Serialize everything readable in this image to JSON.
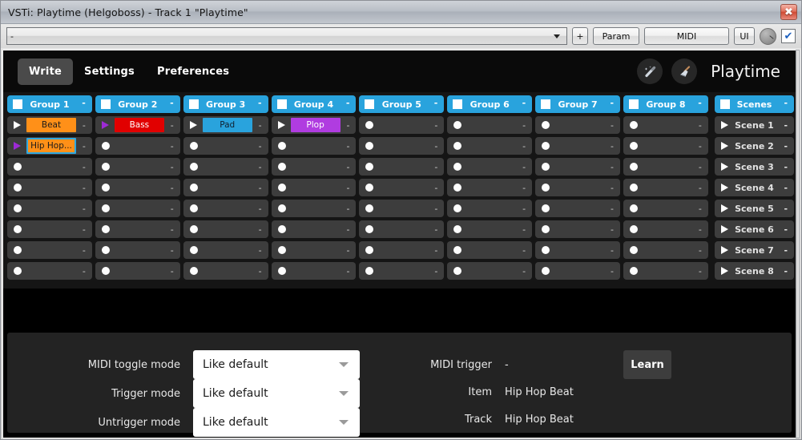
{
  "window": {
    "title": "VSTi: Playtime (Helgoboss) - Track 1 \"Playtime\"",
    "close_label": "✖"
  },
  "host_toolbar": {
    "preset_value": "-",
    "add_label": "+",
    "param_label": "Param",
    "midi_label": "MIDI",
    "ui_label": "UI",
    "checkbox_mark": "✔"
  },
  "plugin_header": {
    "tabs": [
      {
        "label": "Write",
        "active": true
      },
      {
        "label": "Settings",
        "active": false
      },
      {
        "label": "Preferences",
        "active": false
      }
    ],
    "plugin_name": "Playtime"
  },
  "colors": {
    "accent_cyan": "#29a3dd",
    "clip_orange": "#ff9018",
    "clip_red": "#e10000",
    "clip_blue": "#29a3dd",
    "clip_purple": "#b03ce0",
    "slot_grey": "#3d3d3d",
    "selection_border": "#2fa8e0",
    "play_purple": "#9d2ad6"
  },
  "matrix": {
    "dash": "-",
    "groups": [
      {
        "name": "Group 1",
        "dash": "-"
      },
      {
        "name": "Group 2",
        "dash": "-"
      },
      {
        "name": "Group 3",
        "dash": "-"
      },
      {
        "name": "Group 4",
        "dash": "-"
      },
      {
        "name": "Group 5",
        "dash": "-"
      },
      {
        "name": "Group 6",
        "dash": "-"
      },
      {
        "name": "Group 7",
        "dash": "-"
      },
      {
        "name": "Group 8",
        "dash": "-"
      }
    ],
    "scenes_header": {
      "name": "Scenes",
      "dash": "-"
    },
    "scenes": [
      {
        "name": "Scene 1",
        "dash": "-"
      },
      {
        "name": "Scene 2",
        "dash": "-"
      },
      {
        "name": "Scene 3",
        "dash": "-"
      },
      {
        "name": "Scene 4",
        "dash": "-"
      },
      {
        "name": "Scene 5",
        "dash": "-"
      },
      {
        "name": "Scene 6",
        "dash": "-"
      },
      {
        "name": "Scene 7",
        "dash": "-"
      },
      {
        "name": "Scene 8",
        "dash": "-"
      }
    ],
    "rows": [
      [
        {
          "clip": "Beat",
          "color": "#ff9018",
          "text": "#1a1a1a",
          "control": "play",
          "control_color": "white",
          "selected": false
        },
        {
          "clip": "Bass",
          "color": "#e10000",
          "text": "#ffffff",
          "control": "play",
          "control_color": "purple",
          "selected": false
        },
        {
          "clip": "Pad",
          "color": "#29a3dd",
          "text": "#102030",
          "control": "play",
          "control_color": "white",
          "selected": false
        },
        {
          "clip": "Plop",
          "color": "#b03ce0",
          "text": "#ffffff",
          "control": "play",
          "control_color": "white",
          "selected": false
        },
        {
          "clip": null,
          "control": "record"
        },
        {
          "clip": null,
          "control": "record"
        },
        {
          "clip": null,
          "control": "record"
        },
        {
          "clip": null,
          "control": "record"
        }
      ],
      [
        {
          "clip": "Hip Hop...",
          "color": "#ff9018",
          "text": "#1a1a1a",
          "control": "play",
          "control_color": "purple",
          "selected": true
        },
        {
          "clip": null,
          "control": "record"
        },
        {
          "clip": null,
          "control": "record"
        },
        {
          "clip": null,
          "control": "record"
        },
        {
          "clip": null,
          "control": "record"
        },
        {
          "clip": null,
          "control": "record"
        },
        {
          "clip": null,
          "control": "record"
        },
        {
          "clip": null,
          "control": "record"
        }
      ],
      [
        {
          "clip": null,
          "control": "record"
        },
        {
          "clip": null,
          "control": "record"
        },
        {
          "clip": null,
          "control": "record"
        },
        {
          "clip": null,
          "control": "record"
        },
        {
          "clip": null,
          "control": "record"
        },
        {
          "clip": null,
          "control": "record"
        },
        {
          "clip": null,
          "control": "record"
        },
        {
          "clip": null,
          "control": "record"
        }
      ],
      [
        {
          "clip": null,
          "control": "record"
        },
        {
          "clip": null,
          "control": "record"
        },
        {
          "clip": null,
          "control": "record"
        },
        {
          "clip": null,
          "control": "record"
        },
        {
          "clip": null,
          "control": "record"
        },
        {
          "clip": null,
          "control": "record"
        },
        {
          "clip": null,
          "control": "record"
        },
        {
          "clip": null,
          "control": "record"
        }
      ],
      [
        {
          "clip": null,
          "control": "record"
        },
        {
          "clip": null,
          "control": "record"
        },
        {
          "clip": null,
          "control": "record"
        },
        {
          "clip": null,
          "control": "record"
        },
        {
          "clip": null,
          "control": "record"
        },
        {
          "clip": null,
          "control": "record"
        },
        {
          "clip": null,
          "control": "record"
        },
        {
          "clip": null,
          "control": "record"
        }
      ],
      [
        {
          "clip": null,
          "control": "record"
        },
        {
          "clip": null,
          "control": "record"
        },
        {
          "clip": null,
          "control": "record"
        },
        {
          "clip": null,
          "control": "record"
        },
        {
          "clip": null,
          "control": "record"
        },
        {
          "clip": null,
          "control": "record"
        },
        {
          "clip": null,
          "control": "record"
        },
        {
          "clip": null,
          "control": "record"
        }
      ],
      [
        {
          "clip": null,
          "control": "record"
        },
        {
          "clip": null,
          "control": "record"
        },
        {
          "clip": null,
          "control": "record"
        },
        {
          "clip": null,
          "control": "record"
        },
        {
          "clip": null,
          "control": "record"
        },
        {
          "clip": null,
          "control": "record"
        },
        {
          "clip": null,
          "control": "record"
        },
        {
          "clip": null,
          "control": "record"
        }
      ],
      [
        {
          "clip": null,
          "control": "record"
        },
        {
          "clip": null,
          "control": "record"
        },
        {
          "clip": null,
          "control": "record"
        },
        {
          "clip": null,
          "control": "record"
        },
        {
          "clip": null,
          "control": "record"
        },
        {
          "clip": null,
          "control": "record"
        },
        {
          "clip": null,
          "control": "record"
        },
        {
          "clip": null,
          "control": "record"
        }
      ]
    ]
  },
  "inspector": {
    "midi_toggle_mode": {
      "label": "MIDI toggle mode",
      "value": "Like default"
    },
    "trigger_mode": {
      "label": "Trigger mode",
      "value": "Like default"
    },
    "untrigger_mode": {
      "label": "Untrigger mode",
      "value": "Like default"
    },
    "midi_trigger": {
      "label": "MIDI trigger",
      "value": "-"
    },
    "learn_label": "Learn",
    "item": {
      "label": "Item",
      "value": "Hip Hop Beat"
    },
    "track": {
      "label": "Track",
      "value": "Hip Hop Beat"
    }
  }
}
